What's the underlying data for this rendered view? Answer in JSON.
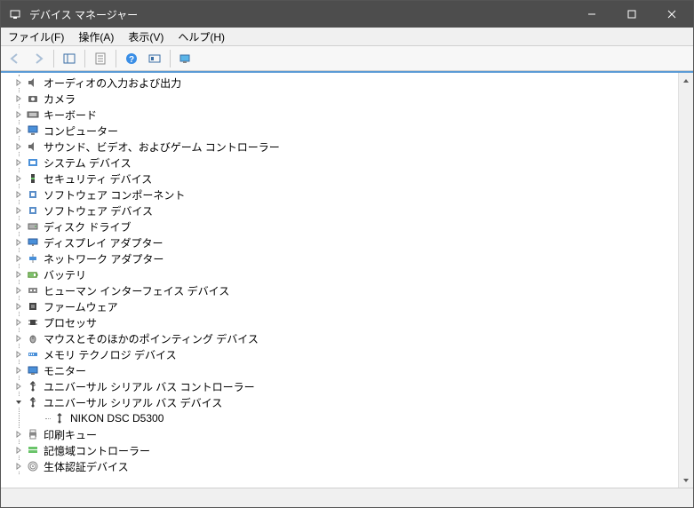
{
  "window": {
    "title": "デバイス マネージャー"
  },
  "menu": {
    "file": "ファイル(F)",
    "action": "操作(A)",
    "view": "表示(V)",
    "help": "ヘルプ(H)"
  },
  "tree": {
    "categories": [
      {
        "label": "オーディオの入力および出力",
        "icon": "audio"
      },
      {
        "label": "カメラ",
        "icon": "camera"
      },
      {
        "label": "キーボード",
        "icon": "keyboard"
      },
      {
        "label": "コンピューター",
        "icon": "computer"
      },
      {
        "label": "サウンド、ビデオ、およびゲーム コントローラー",
        "icon": "audio"
      },
      {
        "label": "システム デバイス",
        "icon": "system"
      },
      {
        "label": "セキュリティ デバイス",
        "icon": "security"
      },
      {
        "label": "ソフトウェア コンポーネント",
        "icon": "software"
      },
      {
        "label": "ソフトウェア デバイス",
        "icon": "software"
      },
      {
        "label": "ディスク ドライブ",
        "icon": "disk"
      },
      {
        "label": "ディスプレイ アダプター",
        "icon": "display"
      },
      {
        "label": "ネットワーク アダプター",
        "icon": "network"
      },
      {
        "label": "バッテリ",
        "icon": "battery"
      },
      {
        "label": "ヒューマン インターフェイス デバイス",
        "icon": "hid"
      },
      {
        "label": "ファームウェア",
        "icon": "firmware"
      },
      {
        "label": "プロセッサ",
        "icon": "processor"
      },
      {
        "label": "マウスとそのほかのポインティング デバイス",
        "icon": "mouse"
      },
      {
        "label": "メモリ テクノロジ デバイス",
        "icon": "memory"
      },
      {
        "label": "モニター",
        "icon": "monitor"
      },
      {
        "label": "ユニバーサル シリアル バス コントローラー",
        "icon": "usb"
      },
      {
        "label": "ユニバーサル シリアル バス デバイス",
        "icon": "usb",
        "expanded": true,
        "children": [
          {
            "label": "NIKON DSC D5300",
            "icon": "usb-dev"
          }
        ]
      },
      {
        "label": "印刷キュー",
        "icon": "printer"
      },
      {
        "label": "記憶域コントローラー",
        "icon": "storage"
      },
      {
        "label": "生体認証デバイス",
        "icon": "biometric"
      }
    ]
  }
}
